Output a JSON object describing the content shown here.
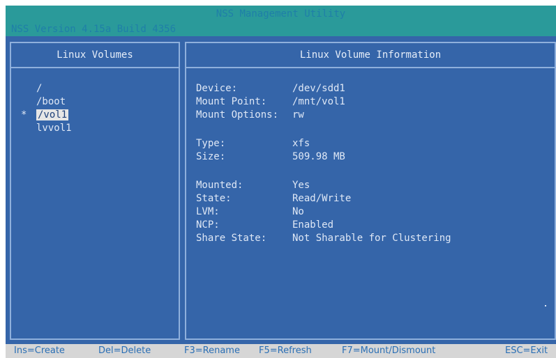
{
  "header": {
    "title": "NSS Management Utility",
    "version": "NSS Version 4.15a  Build 4356"
  },
  "left_panel": {
    "title": "Linux Volumes",
    "volumes": [
      {
        "marker": "",
        "name": "/"
      },
      {
        "marker": "",
        "name": "/boot"
      },
      {
        "marker": "*",
        "name": "/vol1",
        "selected": true
      },
      {
        "marker": "",
        "name": "lvvol1"
      }
    ]
  },
  "right_panel": {
    "title": "Linux Volume Information",
    "device_label": "Device:",
    "device_value": "/dev/sdd1",
    "mount_point_label": "Mount Point:",
    "mount_point_value": "/mnt/vol1",
    "mount_options_label": "Mount Options:",
    "mount_options_value": "rw",
    "type_label": "Type:",
    "type_value": "xfs",
    "size_label": "Size:",
    "size_value": "509.98 MB",
    "mounted_label": "Mounted:",
    "mounted_value": "Yes",
    "state_label": "State:",
    "state_value": "Read/Write",
    "lvm_label": "LVM:",
    "lvm_value": "No",
    "ncp_label": "NCP:",
    "ncp_value": "Enabled",
    "share_state_label": "Share State:",
    "share_state_value": "Not Sharable for Clustering"
  },
  "footer": {
    "create": "Ins=Create",
    "delete": "Del=Delete",
    "rename": "F3=Rename",
    "refresh": "F5=Refresh",
    "mount": "F7=Mount/Dismount",
    "exit": "ESC=Exit"
  },
  "colors": {
    "background": "#3565a9",
    "header": "#2a9a9a",
    "border": "#8fb0dc",
    "footer": "#d6d6d6",
    "footer_text": "#2a6fb5"
  }
}
